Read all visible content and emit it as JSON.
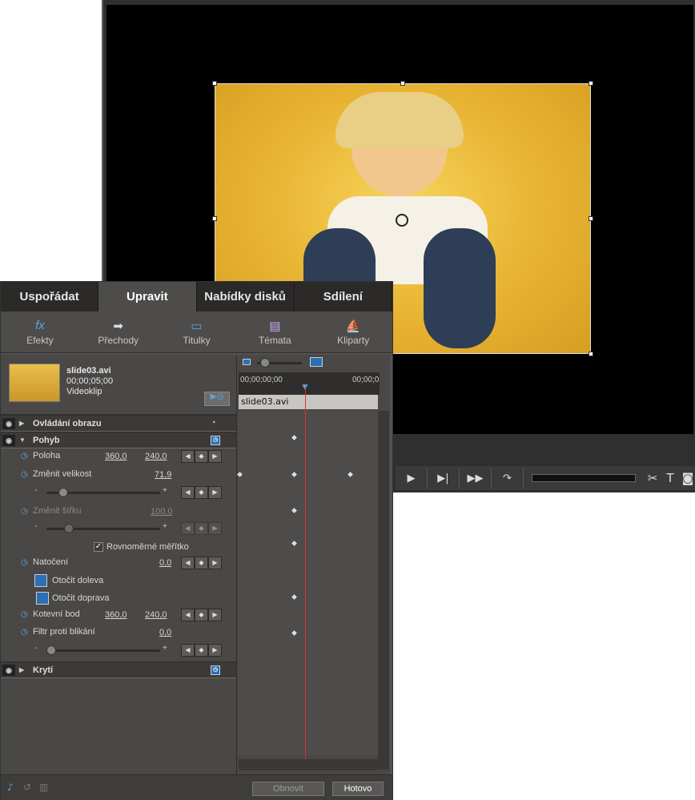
{
  "tabs": [
    "Uspořádat",
    "Upravit",
    "Nabídky disků",
    "Sdílení"
  ],
  "tools": [
    {
      "label": "Efekty",
      "icon": "fx-icon"
    },
    {
      "label": "Přechody",
      "icon": "arrow-right-icon"
    },
    {
      "label": "Titulky",
      "icon": "title-icon"
    },
    {
      "label": "Témata",
      "icon": "theme-icon"
    },
    {
      "label": "Kliparty",
      "icon": "clipart-icon"
    }
  ],
  "clip": {
    "name": "slide03.avi",
    "time": "00;00;05;00",
    "type": "Videoklip"
  },
  "sections": {
    "image_control": "Ovládání obrazu",
    "motion": "Pohyb",
    "opacity": "Krytí"
  },
  "props": {
    "position": {
      "label": "Poloha",
      "x": "360,0",
      "y": "240,0"
    },
    "scale": {
      "label": "Změnit velikost",
      "value": "71,9"
    },
    "scale_width": {
      "label": "Změnit šířku",
      "value": "100,0"
    },
    "uniform": "Rovnoměrné měřítko",
    "rotation": {
      "label": "Natočení",
      "value": "0,0"
    },
    "rotate_left": "Otočit doleva",
    "rotate_right": "Otočit doprava",
    "anchor": {
      "label": "Kotevní bod",
      "x": "360,0",
      "y": "240,0"
    },
    "flicker": {
      "label": "Filtr proti blikání",
      "value": "0,0"
    }
  },
  "timeline": {
    "start": "00;00;00;00",
    "end": "00;00;0",
    "clip": "slide03.avi"
  },
  "buttons": {
    "reset": "Obnovit",
    "done": "Hotovo"
  }
}
